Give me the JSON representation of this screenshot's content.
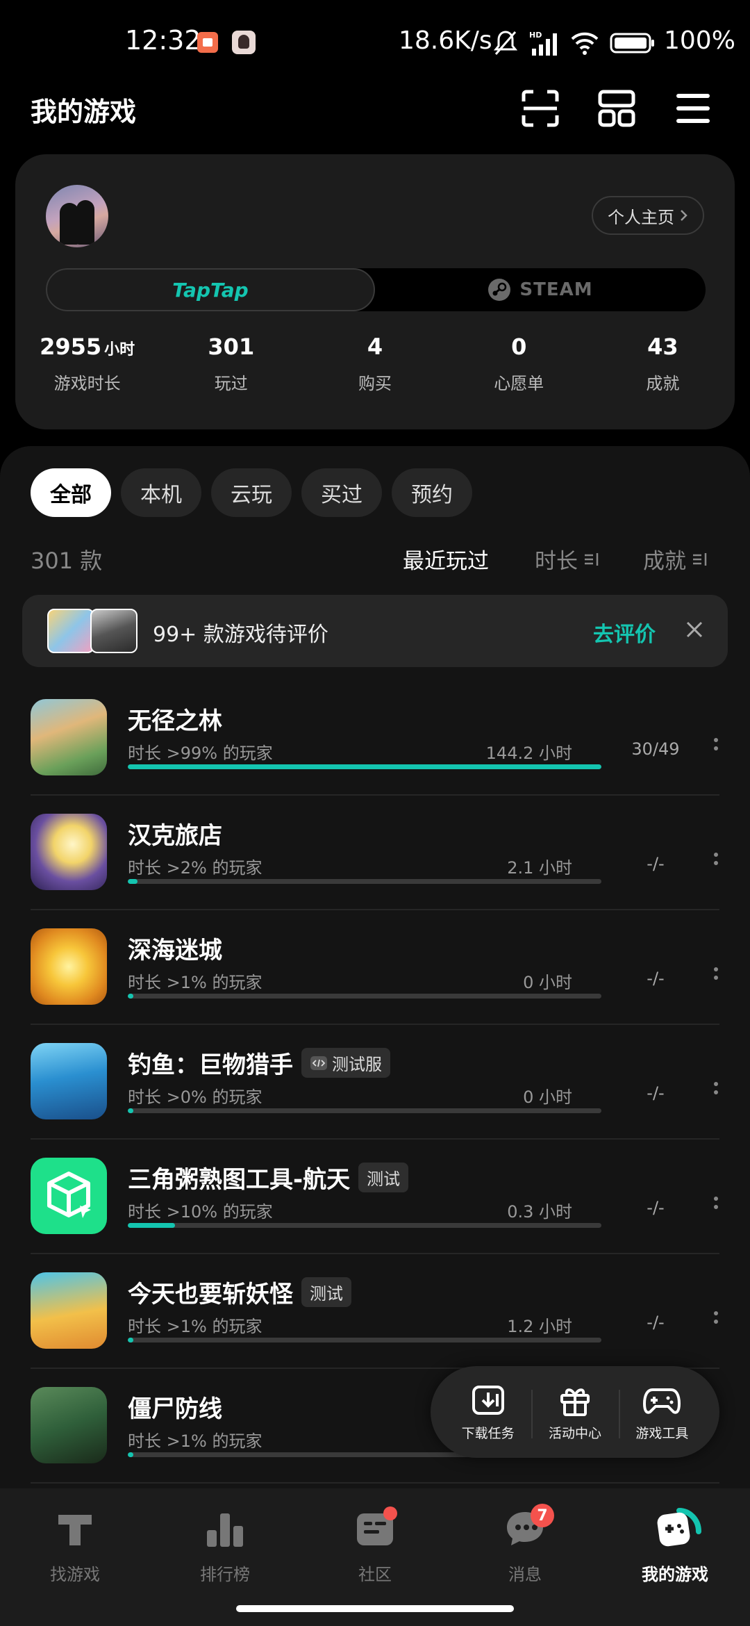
{
  "status_bar": {
    "time": "12:32",
    "speed": "18.6K/s",
    "battery": "100%"
  },
  "header": {
    "title": "我的游戏"
  },
  "profile": {
    "home_label": "个人主页",
    "platforms": [
      "TapTap",
      "STEAM"
    ],
    "stats": [
      {
        "value": "2955",
        "unit": "小时",
        "label": "游戏时长"
      },
      {
        "value": "301",
        "unit": "",
        "label": "玩过"
      },
      {
        "value": "4",
        "unit": "",
        "label": "购买"
      },
      {
        "value": "0",
        "unit": "",
        "label": "心愿单"
      },
      {
        "value": "43",
        "unit": "",
        "label": "成就"
      }
    ]
  },
  "filters": [
    "全部",
    "本机",
    "云玩",
    "买过",
    "预约"
  ],
  "list": {
    "count": "301 款",
    "sort_options": [
      "最近玩过",
      "时长",
      "成就"
    ]
  },
  "review_banner": {
    "text": "99+ 款游戏待评价",
    "action": "去评价"
  },
  "games": [
    {
      "name": "无径之林",
      "tag": "",
      "sub": "时长 >99% 的玩家",
      "hours": "144.2 小时",
      "achievements": "30/49",
      "progress": 1.0
    },
    {
      "name": "汉克旅店",
      "tag": "",
      "sub": "时长 >2% 的玩家",
      "hours": "2.1 小时",
      "achievements": "-/-",
      "progress": 0.02
    },
    {
      "name": "深海迷城",
      "tag": "",
      "sub": "时长 >1% 的玩家",
      "hours": "0 小时",
      "achievements": "-/-",
      "progress": 0.01
    },
    {
      "name": "钓鱼：巨物猎手",
      "tag": "测试服",
      "sub": "时长 >0% 的玩家",
      "hours": "0 小时",
      "achievements": "-/-",
      "progress": 0.0
    },
    {
      "name": "三角粥熟图工具-航天",
      "tag": "测试",
      "sub": "时长 >10% 的玩家",
      "hours": "0.3 小时",
      "achievements": "-/-",
      "progress": 0.1
    },
    {
      "name": "今天也要斩妖怪",
      "tag": "测试",
      "sub": "时长 >1% 的玩家",
      "hours": "1.2 小时",
      "achievements": "-/-",
      "progress": 0.01
    },
    {
      "name": "僵尸防线",
      "tag": "",
      "sub": "时长 >1% 的玩家",
      "hours": "",
      "achievements": "",
      "progress": 0.01
    }
  ],
  "float_tools": [
    "下载任务",
    "活动中心",
    "游戏工具"
  ],
  "bottom_nav": {
    "items": [
      "找游戏",
      "排行榜",
      "社区",
      "消息",
      "我的游戏"
    ],
    "message_badge": "7"
  },
  "colors": {
    "accent": "#14c5b0",
    "badge": "#f4524d",
    "background": "#000000",
    "card": "#1c1c1c"
  }
}
